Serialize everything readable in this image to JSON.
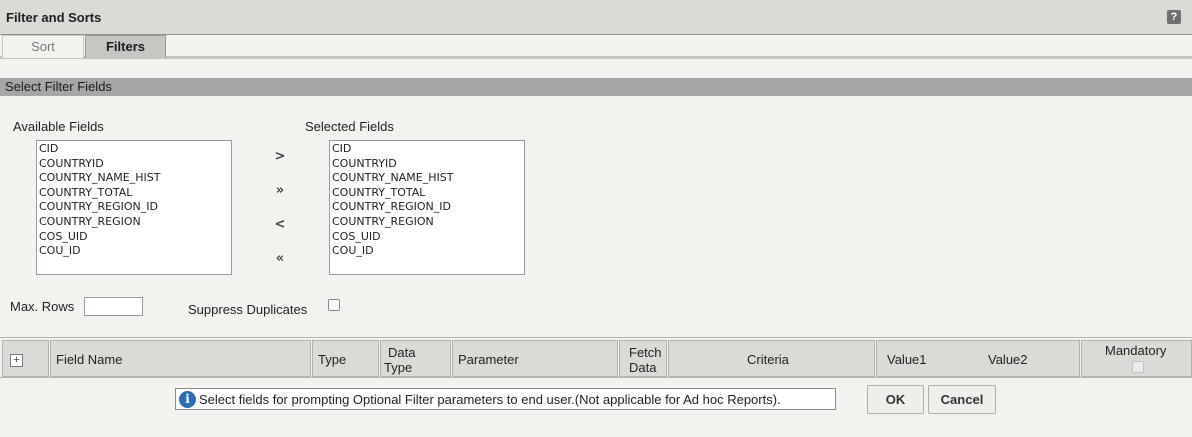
{
  "window": {
    "title": "Filter and Sorts",
    "help_label": "?"
  },
  "tabs": [
    {
      "label": "Sort",
      "active": false
    },
    {
      "label": "Filters",
      "active": true
    }
  ],
  "section": {
    "title": "Select Filter Fields"
  },
  "available": {
    "label": "Available Fields",
    "items": [
      "CID",
      "COUNTRYID",
      "COUNTRY_NAME_HIST",
      "COUNTRY_TOTAL",
      "COUNTRY_REGION_ID",
      "COUNTRY_REGION",
      "COS_UID",
      "COU_ID"
    ]
  },
  "selected": {
    "label": "Selected Fields",
    "items": [
      "CID",
      "COUNTRYID",
      "COUNTRY_NAME_HIST",
      "COUNTRY_TOTAL",
      "COUNTRY_REGION_ID",
      "COUNTRY_REGION",
      "COS_UID",
      "COU_ID"
    ]
  },
  "move_buttons": {
    "add": ">",
    "add_all": "»",
    "remove": "<",
    "remove_all": "«"
  },
  "options": {
    "max_rows_label": "Max. Rows",
    "max_rows_value": "",
    "suppress_label": "Suppress Duplicates",
    "suppress_checked": false
  },
  "grid": {
    "expand_symbol": "+",
    "columns": {
      "field_name": "Field Name",
      "type": "Type",
      "data_type_1": "Data",
      "data_type_2": "Type",
      "parameter": "Parameter",
      "fetch_1": "Fetch",
      "fetch_2": "Data",
      "criteria": "Criteria",
      "value1": "Value1",
      "value2": "Value2",
      "mandatory": "Mandatory"
    }
  },
  "info": {
    "icon_symbol": "i",
    "text": "Select fields for prompting Optional Filter parameters to end user.(Not applicable for Ad hoc Reports)."
  },
  "buttons": {
    "ok": "OK",
    "cancel": "Cancel"
  }
}
